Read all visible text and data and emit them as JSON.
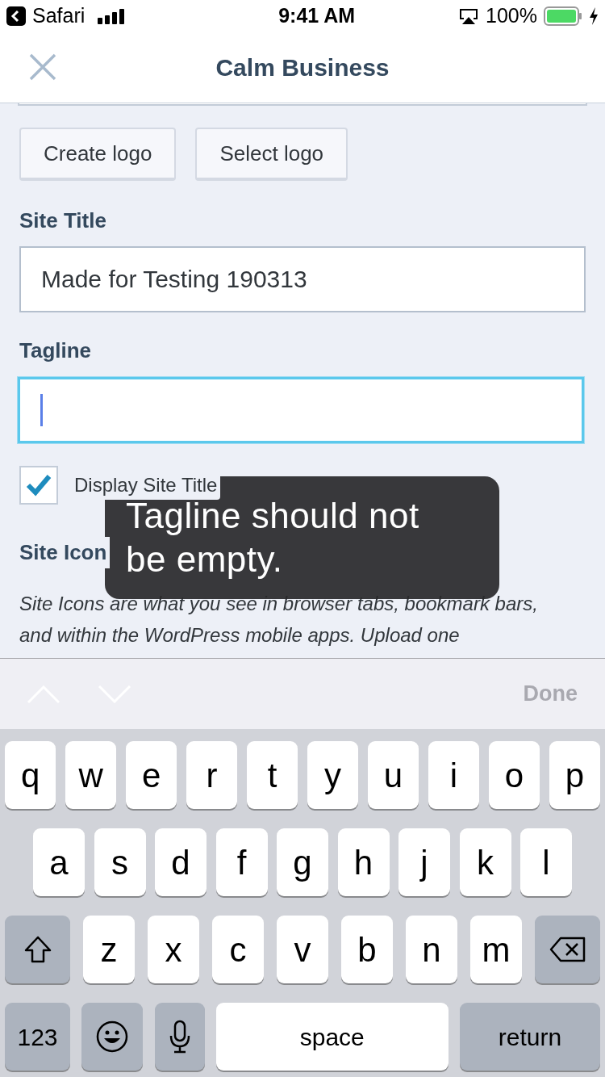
{
  "status_bar": {
    "back_app": "Safari",
    "time": "9:41 AM",
    "battery": "100%"
  },
  "header": {
    "title": "Calm Business"
  },
  "logo_buttons": [
    "Create logo",
    "Select logo"
  ],
  "site_title": {
    "label": "Site Title",
    "value": "Made for Testing 190313"
  },
  "tagline": {
    "label": "Tagline",
    "focused": true
  },
  "display_site_title": {
    "label": "Display Site Title",
    "checked": true
  },
  "site_icon": {
    "label": "Site Icon",
    "description": "Site Icons are what you see in browser tabs, bookmark bars, and within the WordPress mobile apps. Upload one"
  },
  "toast": {
    "message": "Tagline should not be empty."
  },
  "keyboard_bar": {
    "done": {
      "label": "Done",
      "disabled": true
    }
  },
  "keyboard": {
    "rows": [
      {
        "keys": [
          {
            "kind": "letter",
            "label": "q"
          },
          {
            "kind": "letter",
            "label": "w"
          },
          {
            "kind": "letter",
            "label": "e"
          },
          {
            "kind": "letter",
            "label": "r"
          },
          {
            "kind": "letter",
            "label": "t"
          },
          {
            "kind": "letter",
            "label": "y"
          },
          {
            "kind": "letter",
            "label": "u"
          },
          {
            "kind": "letter",
            "label": "i"
          },
          {
            "kind": "letter",
            "label": "o"
          },
          {
            "kind": "letter",
            "label": "p"
          }
        ]
      },
      {
        "keys": [
          {
            "kind": "letter",
            "label": "a"
          },
          {
            "kind": "letter",
            "label": "s"
          },
          {
            "kind": "letter",
            "label": "d"
          },
          {
            "kind": "letter",
            "label": "f"
          },
          {
            "kind": "letter",
            "label": "g"
          },
          {
            "kind": "letter",
            "label": "h"
          },
          {
            "kind": "letter",
            "label": "j"
          },
          {
            "kind": "letter",
            "label": "k"
          },
          {
            "kind": "letter",
            "label": "l"
          }
        ]
      },
      {
        "keys": [
          {
            "kind": "shift"
          },
          {
            "kind": "letter",
            "label": "z"
          },
          {
            "kind": "letter",
            "label": "x"
          },
          {
            "kind": "letter",
            "label": "c"
          },
          {
            "kind": "letter",
            "label": "v"
          },
          {
            "kind": "letter",
            "label": "b"
          },
          {
            "kind": "letter",
            "label": "n"
          },
          {
            "kind": "letter",
            "label": "m"
          },
          {
            "kind": "backspace"
          }
        ]
      },
      {
        "keys": [
          {
            "kind": "function",
            "label": "123"
          },
          {
            "kind": "emoji"
          },
          {
            "kind": "mic"
          },
          {
            "kind": "space",
            "label": "space"
          },
          {
            "kind": "return",
            "label": "return"
          }
        ]
      }
    ]
  }
}
